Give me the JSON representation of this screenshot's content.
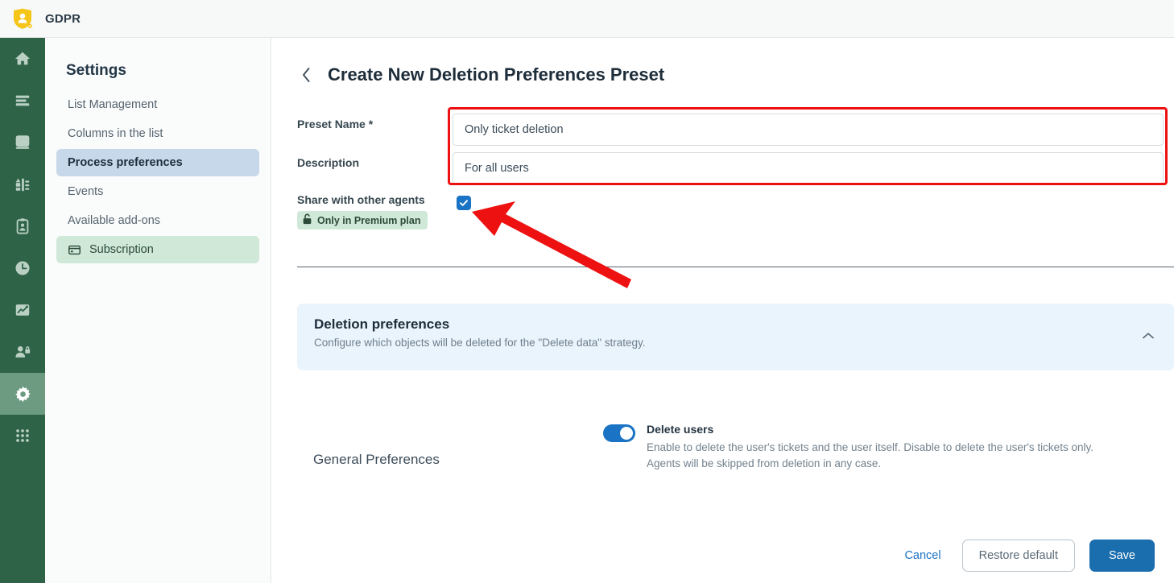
{
  "topbar": {
    "brand": "GDPR",
    "logo_icon": "shield-person-icon",
    "logo_color": "#f5c518"
  },
  "rail": {
    "background": "#2e6347",
    "active_background": "#6d9b81",
    "items": [
      {
        "icon": "home-icon",
        "name": "home",
        "active": false
      },
      {
        "icon": "list-icon",
        "name": "lists",
        "active": false
      },
      {
        "icon": "database-icon",
        "name": "database",
        "active": false
      },
      {
        "icon": "chart-bar-icon",
        "name": "reports",
        "active": false
      },
      {
        "icon": "clipboard-person-icon",
        "name": "audit",
        "active": false
      },
      {
        "icon": "clock-icon",
        "name": "history",
        "active": false
      },
      {
        "icon": "analytics-icon",
        "name": "analytics",
        "active": false
      },
      {
        "icon": "user-lock-icon",
        "name": "user-privacy",
        "active": false
      },
      {
        "icon": "gear-icon",
        "name": "settings",
        "active": true
      },
      {
        "icon": "apps-grid-icon",
        "name": "apps",
        "active": false
      }
    ]
  },
  "sidebar": {
    "title": "Settings",
    "items": [
      {
        "label": "List Management",
        "active": false,
        "icon": null
      },
      {
        "label": "Columns in the list",
        "active": false,
        "icon": null
      },
      {
        "label": "Process preferences",
        "active": true,
        "icon": null
      },
      {
        "label": "Events",
        "active": false,
        "icon": null
      },
      {
        "label": "Available add-ons",
        "active": false,
        "icon": null
      },
      {
        "label": "Subscription",
        "active": false,
        "icon": "credit-card-icon",
        "highlight": true
      }
    ],
    "active_color": "#c6d8e9",
    "subscription_color": "#cfe8d8"
  },
  "main": {
    "back_icon": "chevron-left-icon",
    "title": "Create New Deletion Preferences Preset",
    "form": {
      "preset_name": {
        "label": "Preset Name *",
        "value": "Only ticket deletion",
        "placeholder": "Preset Name"
      },
      "description": {
        "label": "Description",
        "value": "For all users",
        "placeholder": "Description"
      },
      "share": {
        "label": "Share with other agents",
        "badge": "Only in Premium plan",
        "badge_icon": "lock-open-icon",
        "checked": true,
        "check_icon": "check-icon"
      }
    },
    "panel": {
      "title": "Deletion preferences",
      "subtitle": "Configure which objects will be deleted for the \"Delete data\" strategy.",
      "collapse_icon": "chevron-up-icon",
      "background": "#eaf4fc"
    },
    "general_preferences": {
      "section_label": "General Preferences",
      "toggle": {
        "name": "Delete users",
        "enabled": true,
        "description_line1": "Enable to delete the user's tickets and the user itself. Disable to delete the user's tickets only.",
        "description_line2": "Agents will be skipped from deletion in any case.",
        "accent": "#1a73c4"
      }
    },
    "footer": {
      "cancel": "Cancel",
      "restore": "Restore default",
      "save": "Save",
      "save_color": "#1a6eae"
    }
  },
  "annotations": {
    "highlight_box_color": "#ee1111",
    "arrow_color": "#ee1111",
    "arrow_target": "share-with-other-agents-checkbox"
  }
}
